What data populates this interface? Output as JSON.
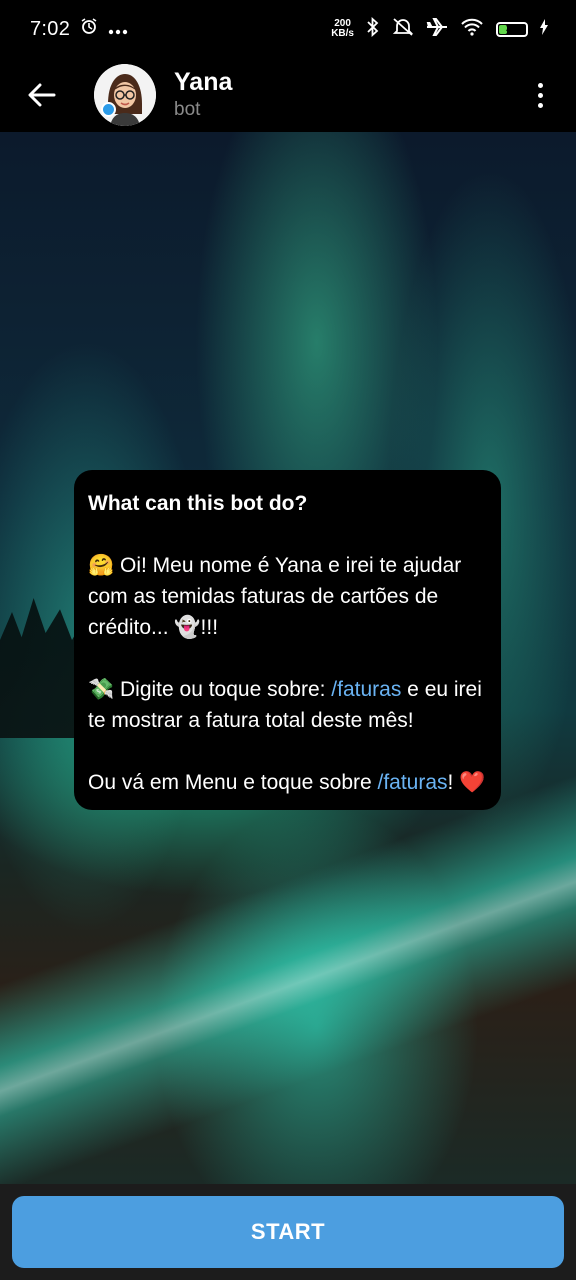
{
  "status_bar": {
    "time": "7:02",
    "net_speed_value": "200",
    "net_speed_unit": "KB/s",
    "battery_level": "30",
    "battery_fraction": 0.3,
    "icons": [
      "alarm-icon",
      "more-notifications-icon",
      "bluetooth-icon",
      "mute-icon",
      "airplane-icon",
      "wifi-icon",
      "battery-icon",
      "charging-icon"
    ]
  },
  "header": {
    "title": "Yana",
    "subtitle": "bot",
    "back_icon": "arrow-left-icon",
    "menu_icon": "more-vertical-icon"
  },
  "bot_info": {
    "title": "What can this bot do?",
    "para1_emoji": "🤗",
    "para1_text": " Oi! Meu nome é Yana e irei te ajudar com as temidas faturas de cartões de crédito... ",
    "para1_emoji2": "👻",
    "para1_end": "!!!",
    "para2_emoji": "💸",
    "para2_text": " Digite ou toque sobre: ",
    "para2_link": "/faturas",
    "para2_end": " e eu irei te mostrar a fatura total deste mês!",
    "para3_text": "Ou vá em Menu e toque sobre ",
    "para3_link": "/faturas",
    "para3_end": "! ",
    "para3_emoji": "❤️"
  },
  "bottom_bar": {
    "start_label": "START"
  },
  "colors": {
    "link": "#6ab3f3",
    "start_button": "#4c9ee0",
    "battery_fill": "#62d64b"
  }
}
